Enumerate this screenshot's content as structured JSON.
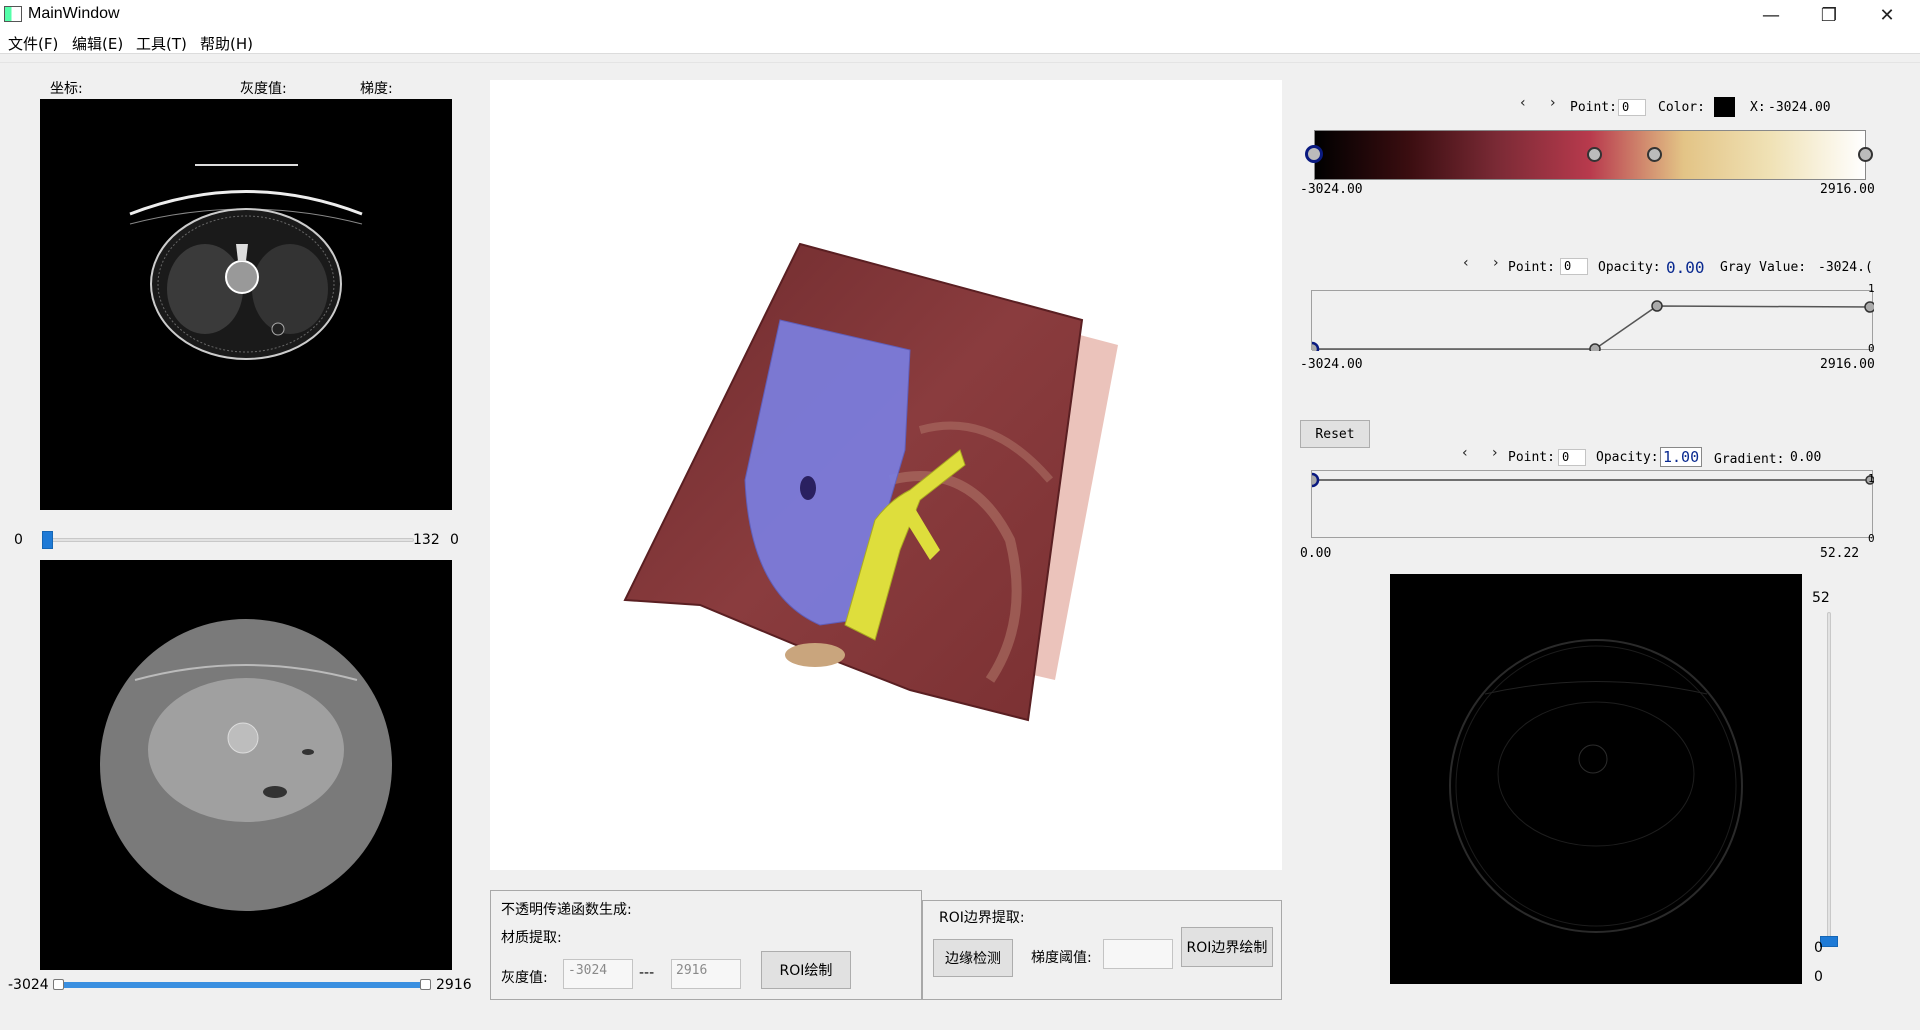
{
  "window": {
    "title": "MainWindow",
    "minimize_glyph": "—",
    "maximize_glyph": "❐",
    "close_glyph": "✕"
  },
  "menu": [
    "文件(F)",
    "编辑(E)",
    "工具(T)",
    "帮助(H)"
  ],
  "left_panel": {
    "coord_label": "坐标:",
    "gray_label": "灰度值:",
    "gradient_label": "梯度:",
    "slice_slider": {
      "min_label": "0",
      "max_label": "132",
      "value_label": "0",
      "value_fraction": 0.0
    },
    "window_range": {
      "min_label": "-3024",
      "max_label": "2916",
      "low_fraction": 0.0,
      "high_fraction": 1.0
    }
  },
  "bottom_controls": {
    "opacity_group_title": "不透明传递函数生成:",
    "material_label": "材质提取:",
    "gray_value_label": "灰度值:",
    "gray_min_placeholder": "-3024",
    "range_sep": "---",
    "gray_max_placeholder": "2916",
    "roi_draw_button": "ROI绘制",
    "roi_group_title": "ROI边界提取:",
    "edge_detect_button": "边缘检测",
    "grad_threshold_label": "梯度阈值:",
    "roi_boundary_button": "ROI边界绘制"
  },
  "color_tf": {
    "arrows": "‹ ›",
    "point_label": "Point:",
    "point_value": "0",
    "color_label": "Color:",
    "selected_color": "#000000",
    "x_label": "X:",
    "x_value": "-3024.00",
    "axis_min": "-3024.00",
    "axis_max": "2916.00",
    "stops_colors": [
      "#000000",
      "#3a0d10",
      "#7a2a35",
      "#b83a4d",
      "#e3c486",
      "#f0e2b6",
      "#ffffff"
    ]
  },
  "opacity_tf": {
    "arrows": "‹ ›",
    "point_label": "Point:",
    "point_value": "0",
    "opacity_label": "Opacity:",
    "opacity_value": "0.00",
    "gray_value_label": "Gray Value:",
    "gray_value": "-3024.(",
    "axis_min": "-3024.00",
    "axis_max": "2916.00",
    "y_max": "1",
    "y_min": "0"
  },
  "gradient_tf": {
    "reset_button": "Reset",
    "arrows": "‹ ›",
    "point_label": "Point:",
    "point_value": "0",
    "opacity_label": "Opacity:",
    "opacity_value": "1.00",
    "gradient_label": "Gradient:",
    "gradient_value": "0.00",
    "axis_min": "0.00",
    "axis_max": "52.22",
    "y_max": "1",
    "y_min": "0"
  },
  "right_view": {
    "slider_max": "52",
    "slider_value": "0",
    "slider_min": "0",
    "value_fraction": 0.0
  }
}
